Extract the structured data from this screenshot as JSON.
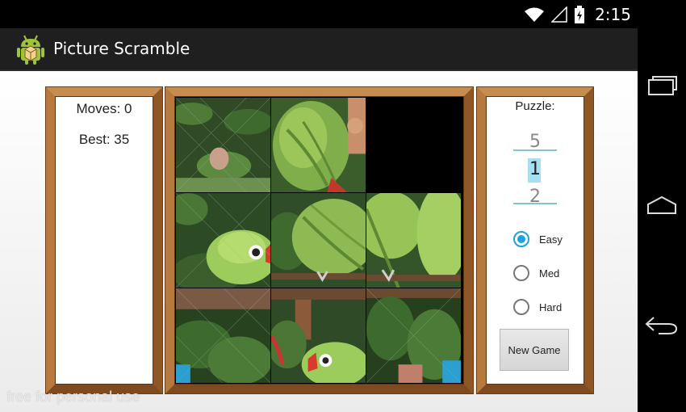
{
  "status_bar": {
    "time": "2:15",
    "icons": [
      "wifi-icon",
      "signal-icon",
      "battery-icon"
    ]
  },
  "app": {
    "title": "Picture Scramble",
    "icon": "android-icon"
  },
  "stats": {
    "moves": "Moves: 0",
    "best": "Best: 35"
  },
  "puzzle_panel": {
    "label": "Puzzle:",
    "picker": {
      "prev": "5",
      "selected": "1",
      "next": "2"
    },
    "difficulty": [
      {
        "label": "Easy",
        "checked": true
      },
      {
        "label": "Med",
        "checked": false
      },
      {
        "label": "Hard",
        "checked": false
      }
    ],
    "new_game_label": "New Game"
  },
  "navigation": [
    "recent-apps-icon",
    "home-icon",
    "back-icon"
  ],
  "watermark": "free for personal use",
  "colors": {
    "accent": "#1aa3e0",
    "wood": "#a86b35",
    "action_bar": "#1f1f1f"
  }
}
